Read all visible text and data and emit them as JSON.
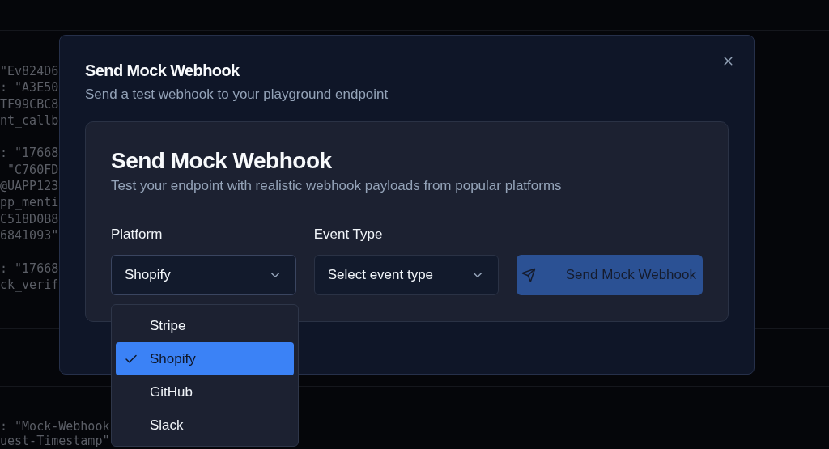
{
  "background_code": {
    "upper_blocks": [
      [
        "\"Ev824D6",
        ": \"A3E50",
        "TF99CBC8",
        "nt_callb"
      ],
      [
        ": \"17668",
        " \"C760FD",
        "@UAPP123",
        "pp_menti",
        "C518D0B8",
        "6841093\""
      ],
      [
        ": \"17668",
        "ck_verif"
      ]
    ],
    "lower_lines": [
      ": \"Mock-Webhook",
      "uest-Timestamp\""
    ]
  },
  "dialog": {
    "title": "Send Mock Webhook",
    "subtitle": "Send a test webhook to your playground endpoint",
    "card": {
      "title": "Send Mock Webhook",
      "description": "Test your endpoint with realistic webhook payloads from popular platforms",
      "fields": [
        {
          "label": "Platform",
          "value": "Shopify",
          "expanded": true
        },
        {
          "label": "Event Type",
          "placeholder": "Select event type",
          "expanded": false
        }
      ],
      "send_button": {
        "label": "Send Mock Webhook",
        "disabled": true
      }
    }
  },
  "dropdown": {
    "options": [
      {
        "label": "Stripe",
        "selected": false
      },
      {
        "label": "Shopify",
        "selected": true
      },
      {
        "label": "GitHub",
        "selected": false
      },
      {
        "label": "Slack",
        "selected": false
      }
    ]
  }
}
